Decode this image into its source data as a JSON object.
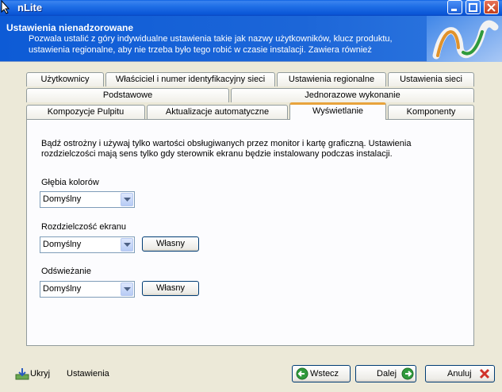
{
  "window": {
    "title": "nLite"
  },
  "header": {
    "title": "Ustawienia nienadzorowane",
    "description": "Pozwala ustalić z góry indywidualne ustawienia takie jak nazwy użytkowników, klucz produktu, ustawienia regionalne, aby nie trzeba było tego robić w czasie instalacji. Zawiera również"
  },
  "tabs": {
    "row1": [
      "Użytkownicy",
      "Właściciel i numer identyfikacyjny sieci",
      "Ustawienia regionalne",
      "Ustawienia sieci"
    ],
    "row2": [
      "Podstawowe",
      "Jednorazowe wykonanie"
    ],
    "row3": [
      "Kompozycje Pulpitu",
      "Aktualizacje automatyczne",
      "Wyświetlanie",
      "Komponenty"
    ]
  },
  "panel": {
    "warning": "Bądź ostrożny i używaj tylko wartości obsługiwanych przez monitor i kartę graficzną. Ustawienia rozdzielczości mają sens tylko gdy sterownik ekranu będzie instalowany podczas instalacji.",
    "color_depth": {
      "label": "Głębia kolorów",
      "value": "Domyślny"
    },
    "resolution": {
      "label": "Rozdzielczość ekranu",
      "value": "Domyślny",
      "custom_button": "Własny"
    },
    "refresh": {
      "label": "Odświeżanie",
      "value": "Domyślny",
      "custom_button": "Własny"
    }
  },
  "footer": {
    "hide": "Ukryj",
    "settings": "Ustawienia",
    "back": "Wstecz",
    "next": "Dalej",
    "cancel": "Anuluj"
  },
  "colors": {
    "accent": "#0a55d6",
    "active_tab_border": "#e8a33c"
  }
}
